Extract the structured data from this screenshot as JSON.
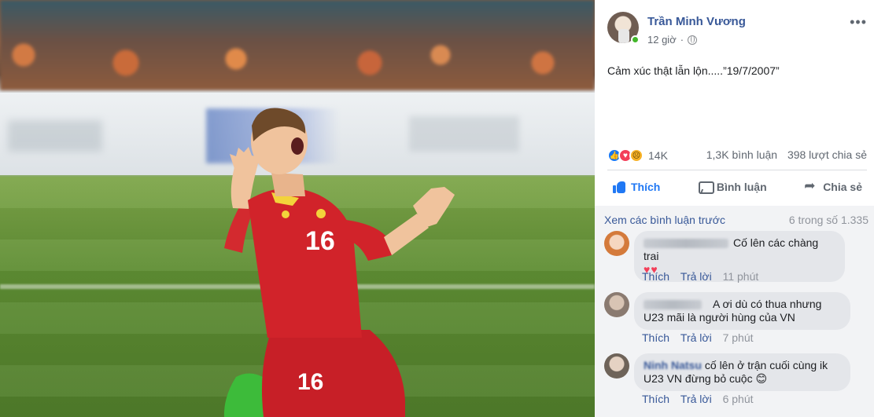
{
  "post": {
    "author": "Trần Minh Vương",
    "time": "12 giờ",
    "text": "Cảm xúc thật lẫn lộn.....”19/7/2007”",
    "reaction_count": "14K",
    "comment_count": "1,3K bình luận",
    "share_count": "398 lượt chia sẻ",
    "actions": {
      "like": "Thích",
      "comment": "Bình luận",
      "share": "Chia sẻ"
    },
    "photo": {
      "jersey_number": "16"
    }
  },
  "comments": {
    "view_previous": "Xem các bình luận trước",
    "count_label": "6 trong số 1.335",
    "action_like": "Thích",
    "action_reply": "Trả lời",
    "items": [
      {
        "author": "",
        "text": "Cố lên các chàng trai",
        "extra": "♥♥",
        "time": "11 phút"
      },
      {
        "author": "",
        "text": "A ơi dù có thua nhưng U23 mãi là người hùng của VN",
        "time": "7 phút"
      },
      {
        "author": "Ninh Natsu",
        "text": "cố lên ở trận cuối cùng ik U23 VN đừng bỏ cuộc 😊",
        "time": "6 phút"
      }
    ]
  },
  "colors": {
    "link": "#385898",
    "like_blue": "#2078f4",
    "jersey_red": "#d1232a"
  }
}
